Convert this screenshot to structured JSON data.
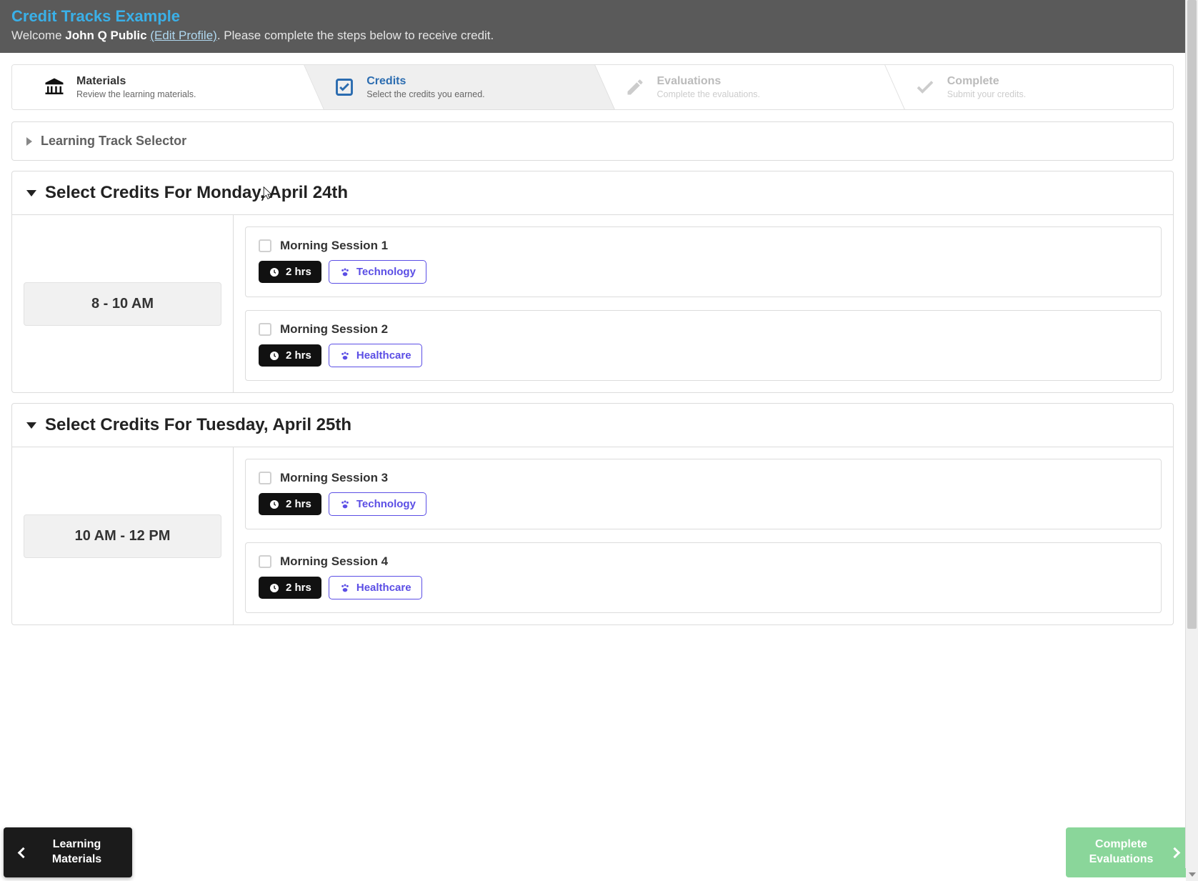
{
  "header": {
    "title": "Credit Tracks Example",
    "welcome_prefix": "Welcome ",
    "user_name": "John Q Public",
    "edit_link": "(Edit Profile)",
    "welcome_suffix": ". Please complete the steps below to receive credit."
  },
  "steps": [
    {
      "title": "Materials",
      "desc": "Review the learning materials.",
      "state": "done"
    },
    {
      "title": "Credits",
      "desc": "Select the credits you earned.",
      "state": "active"
    },
    {
      "title": "Evaluations",
      "desc": "Complete the evaluations.",
      "state": "disabled"
    },
    {
      "title": "Complete",
      "desc": "Submit your credits.",
      "state": "disabled"
    }
  ],
  "track_selector_label": "Learning Track Selector",
  "days": [
    {
      "title": "Select Credits For Monday, April 24th",
      "timeslot": "8 - 10 AM",
      "sessions": [
        {
          "title": "Morning Session 1",
          "hours": "2 hrs",
          "tag": "Technology"
        },
        {
          "title": "Morning Session 2",
          "hours": "2 hrs",
          "tag": "Healthcare"
        }
      ]
    },
    {
      "title": "Select Credits For Tuesday, April 25th",
      "timeslot": "10 AM - 12 PM",
      "sessions": [
        {
          "title": "Morning Session 3",
          "hours": "2 hrs",
          "tag": "Technology"
        },
        {
          "title": "Morning Session 4",
          "hours": "2 hrs",
          "tag": "Healthcare"
        }
      ]
    }
  ],
  "nav": {
    "prev": "Learning Materials",
    "next": "Complete Evaluations"
  }
}
